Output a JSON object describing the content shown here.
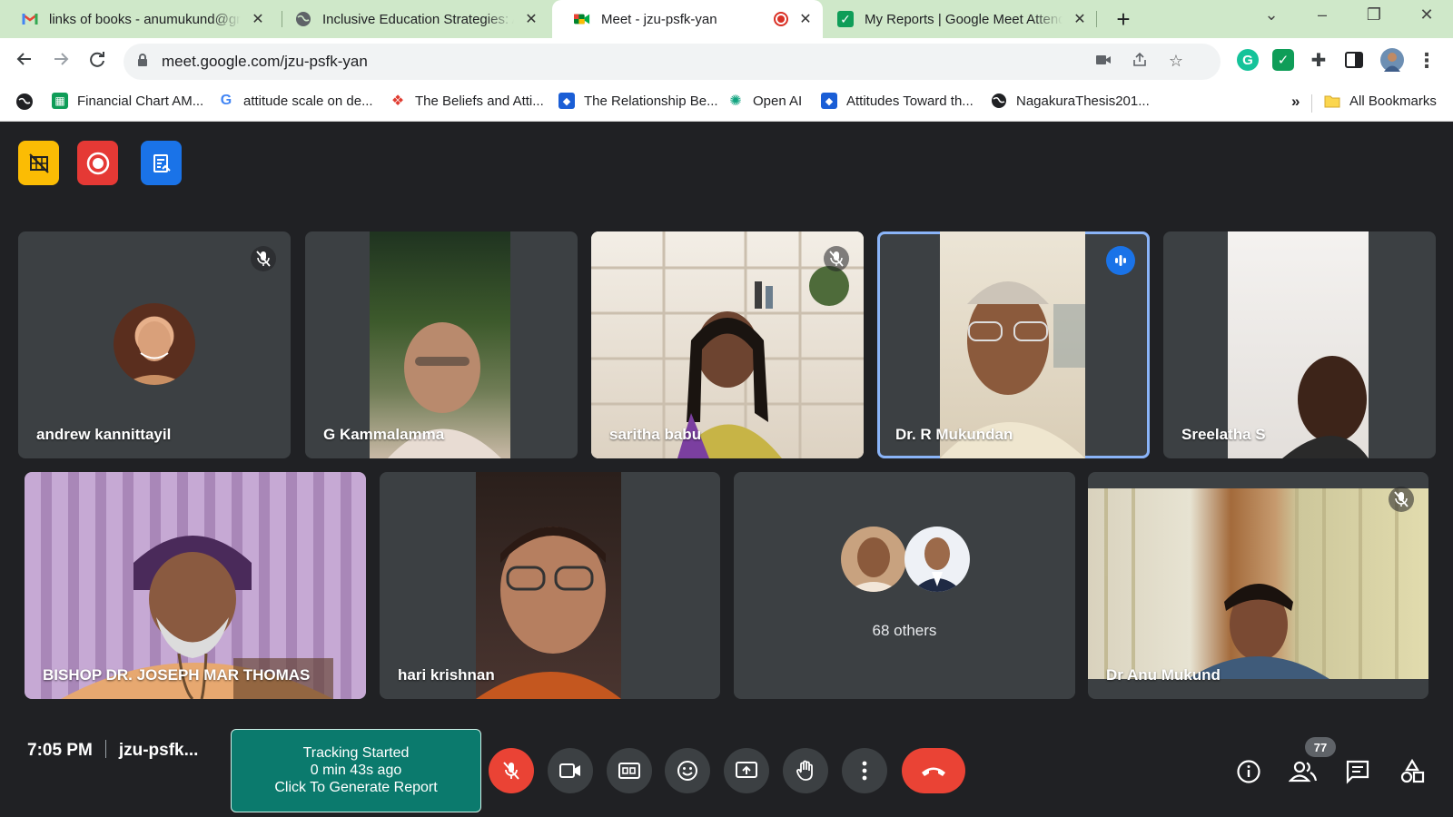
{
  "browser": {
    "tabs": [
      {
        "title": "links of books - anumukund@gmail.com",
        "favicon": "gmail-icon"
      },
      {
        "title": "Inclusive Education Strategies: A",
        "favicon": "globe-icon"
      },
      {
        "title": "Meet - jzu-psfk-yan",
        "favicon": "google-meet-icon",
        "recording_indicator": true
      },
      {
        "title": "My Reports | Google Meet Attendance",
        "favicon": "checkmark-icon"
      }
    ],
    "url": "meet.google.com/jzu-psfk-yan",
    "bookmarks": [
      {
        "label": "Financial Chart AM...",
        "icon": "sheets-icon"
      },
      {
        "label": "attitude scale on de...",
        "icon": "google-icon"
      },
      {
        "label": "The Beliefs and Atti...",
        "icon": "researchgate-icon"
      },
      {
        "label": "The Relationship Be...",
        "icon": "dropbox-icon"
      },
      {
        "label": "Open AI",
        "icon": "openai-icon"
      },
      {
        "label": "Attitudes Toward th...",
        "icon": "dropbox-icon"
      },
      {
        "label": "NagakuraThesis201...",
        "icon": "globe-icon"
      }
    ],
    "overflow_label": "»",
    "all_bookmarks_label": "All Bookmarks"
  },
  "meet": {
    "participants": [
      {
        "name": "andrew kannittayil",
        "muted": true
      },
      {
        "name": "G Kammalamma",
        "muted": false
      },
      {
        "name": "saritha babu",
        "muted": true
      },
      {
        "name": "Dr. R Mukundan",
        "speaking": true
      },
      {
        "name": "Sreelatha S",
        "muted": false
      },
      {
        "name": "BISHOP DR. JOSEPH MAR THOMAS",
        "muted": false
      },
      {
        "name": "hari krishnan",
        "muted": false
      },
      {
        "name": "Dr Anu Mukund",
        "muted": true
      }
    ],
    "others_label": "68 others",
    "time": "7:05 PM",
    "meeting_code": "jzu-psfk...",
    "tracker": {
      "line1": "Tracking Started",
      "line2": "0 min 43s ago",
      "line3": "Click To Generate Report"
    },
    "people_count": "77"
  },
  "colors": {
    "tabstrip": "#cfe8c9",
    "meet_bg": "#202124",
    "tile_bg": "#3c4043",
    "end_call": "#ea4335",
    "tracker": "#0b7a6d",
    "speaking_border": "#8ab4f8"
  }
}
